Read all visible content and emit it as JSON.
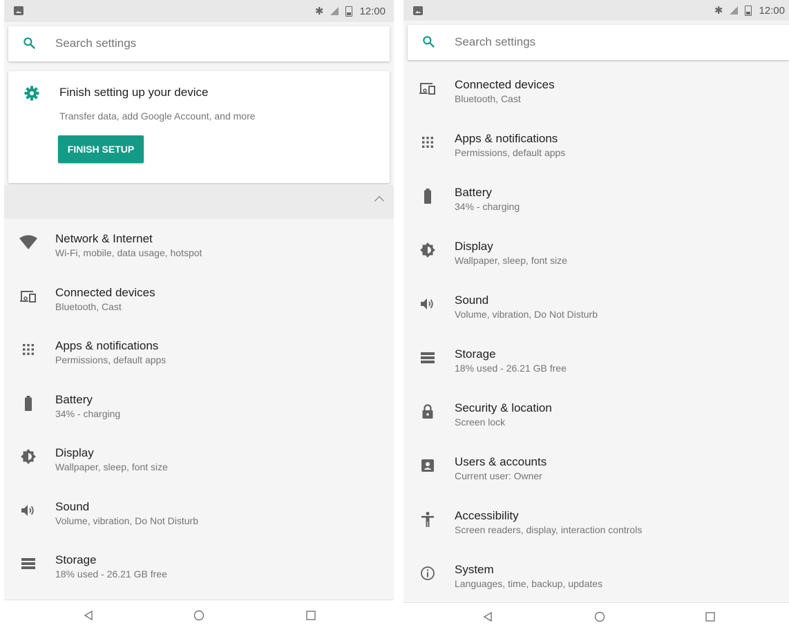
{
  "status_bar": {
    "time": "12:00"
  },
  "search": {
    "placeholder": "Search settings"
  },
  "setup_card": {
    "title": "Finish setting up your device",
    "subtitle": "Transfer data, add Google Account, and more",
    "button_label": "FINISH SETUP"
  },
  "left_items": [
    {
      "title": "Network & Internet",
      "subtitle": "Wi-Fi, mobile, data usage, hotspot",
      "icon": "wifi-icon"
    },
    {
      "title": "Connected devices",
      "subtitle": "Bluetooth, Cast",
      "icon": "connected-devices-icon"
    },
    {
      "title": "Apps & notifications",
      "subtitle": "Permissions, default apps",
      "icon": "apps-grid-icon"
    },
    {
      "title": "Battery",
      "subtitle": "34% - charging",
      "icon": "battery-icon"
    },
    {
      "title": "Display",
      "subtitle": "Wallpaper, sleep, font size",
      "icon": "brightness-icon"
    },
    {
      "title": "Sound",
      "subtitle": "Volume, vibration, Do Not Disturb",
      "icon": "volume-icon"
    },
    {
      "title": "Storage",
      "subtitle": "18% used - 26.21 GB free",
      "icon": "storage-icon"
    }
  ],
  "right_items": [
    {
      "title": "Connected devices",
      "subtitle": "Bluetooth, Cast",
      "icon": "connected-devices-icon"
    },
    {
      "title": "Apps & notifications",
      "subtitle": "Permissions, default apps",
      "icon": "apps-grid-icon"
    },
    {
      "title": "Battery",
      "subtitle": "34% - charging",
      "icon": "battery-icon"
    },
    {
      "title": "Display",
      "subtitle": "Wallpaper, sleep, font size",
      "icon": "brightness-icon"
    },
    {
      "title": "Sound",
      "subtitle": "Volume, vibration, Do Not Disturb",
      "icon": "volume-icon"
    },
    {
      "title": "Storage",
      "subtitle": "18% used - 26.21 GB free",
      "icon": "storage-icon"
    },
    {
      "title": "Security & location",
      "subtitle": "Screen lock",
      "icon": "lock-icon"
    },
    {
      "title": "Users & accounts",
      "subtitle": "Current user: Owner",
      "icon": "account-icon"
    },
    {
      "title": "Accessibility",
      "subtitle": "Screen readers, display, interaction controls",
      "icon": "accessibility-icon"
    },
    {
      "title": "System",
      "subtitle": "Languages, time, backup, updates",
      "icon": "info-icon"
    }
  ],
  "colors": {
    "accent": "#159a87",
    "icon": "#616161",
    "background": "#f5f5f5"
  }
}
